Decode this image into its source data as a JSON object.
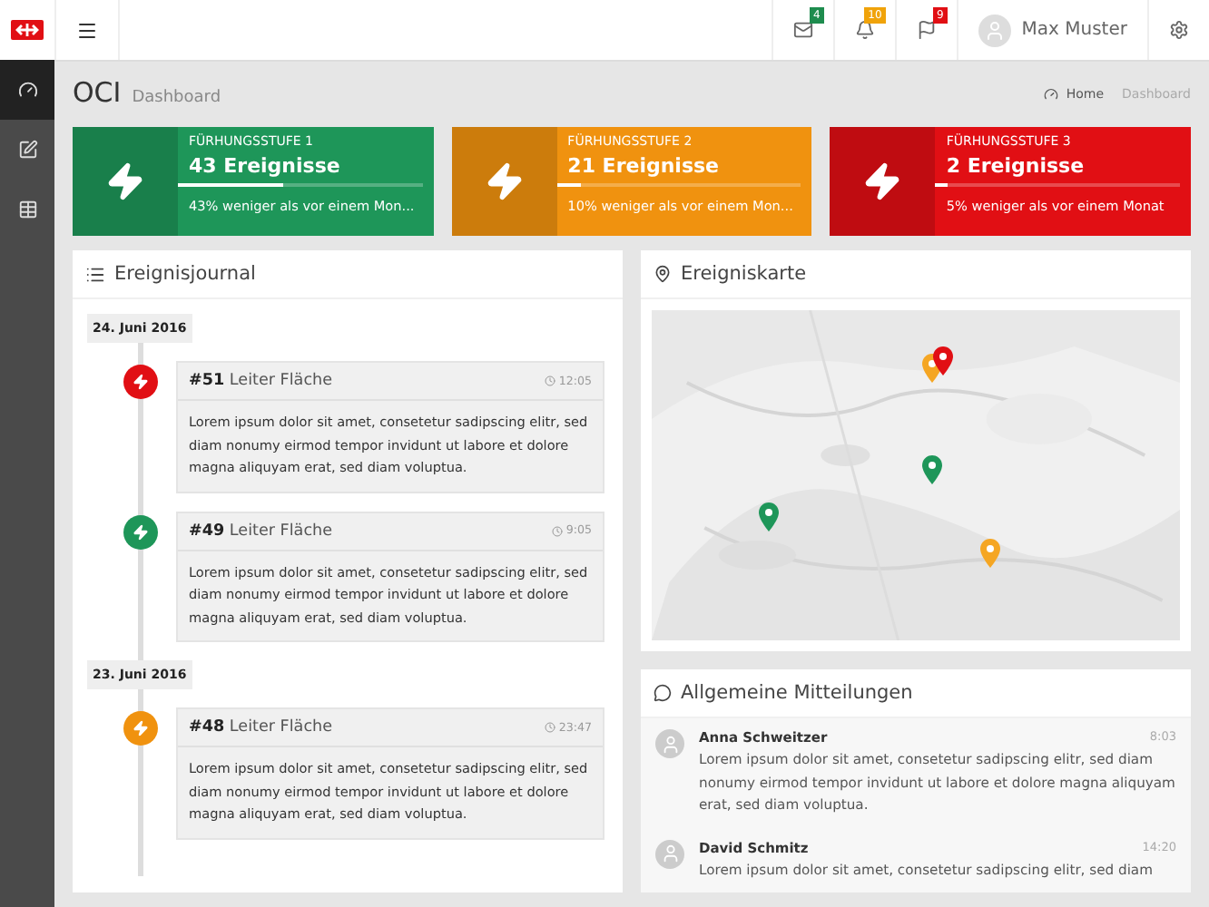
{
  "topbar": {
    "badges": [
      {
        "kind": "mail",
        "count": "4",
        "color": "#1e8c4e"
      },
      {
        "kind": "bell",
        "count": "10",
        "color": "#f0a30a"
      },
      {
        "kind": "flag",
        "count": "9",
        "color": "#e10f14"
      }
    ],
    "user": "Max Muster"
  },
  "sidebar": {
    "items": [
      {
        "kind": "dashboard",
        "selected": true
      },
      {
        "kind": "edit",
        "selected": false
      },
      {
        "kind": "table",
        "selected": false
      }
    ]
  },
  "header": {
    "title": "OCI",
    "subtitle": "Dashboard",
    "breadcrumb": [
      "Home",
      "Dashboard"
    ]
  },
  "stats": [
    {
      "label": "FÜRHUNGSSTUFE 1",
      "value": "43 Ereignisse",
      "note": "43% weniger als vor einem Mon...",
      "level": 0.43,
      "color": "#1e9659"
    },
    {
      "label": "FÜRHUNGSSTUFE 2",
      "value": "21 Ereignisse",
      "note": "10% weniger als vor einem Mon...",
      "level": 0.1,
      "color": "#f0920f"
    },
    {
      "label": "FÜRHUNGSSTUFE 3",
      "value": "2 Ereignisse",
      "note": "5% weniger als vor einem Monat",
      "level": 0.05,
      "color": "#e10f14"
    }
  ],
  "journal": {
    "title": "Ereignisjournal",
    "days": [
      {
        "date": "24. Juni 2016",
        "events": [
          {
            "number": "#51",
            "title": "Leiter Fläche",
            "time": "12:05",
            "color": "#e10f14",
            "text": "Lorem ipsum dolor sit amet, consetetur sadipscing elitr, sed diam nonumy eirmod tempor invidunt ut labore et dolore magna aliquyam erat, sed diam voluptua."
          },
          {
            "number": "#49",
            "title": "Leiter Fläche",
            "time": "9:05",
            "color": "#1e9659",
            "text": "Lorem ipsum dolor sit amet, consetetur sadipscing elitr, sed diam nonumy eirmod tempor invidunt ut labore et dolore magna aliquyam erat, sed diam voluptua."
          }
        ]
      },
      {
        "date": "23. Juni 2016",
        "events": [
          {
            "number": "#48",
            "title": "Leiter Fläche",
            "time": "23:47",
            "color": "#f0920f",
            "text": "Lorem ipsum dolor sit amet, consetetur sadipscing elitr, sed diam nonumy eirmod tempor invidunt ut labore et dolore magna aliquyam erat, sed diam voluptua."
          }
        ]
      }
    ]
  },
  "map": {
    "title": "Ereigniskarte",
    "pins": [
      {
        "color": "#f5a623"
      },
      {
        "color": "#e10f14"
      },
      {
        "color": "#1e9659"
      },
      {
        "color": "#1e9659"
      },
      {
        "color": "#f5a623"
      }
    ]
  },
  "messages": {
    "title": "Allgemeine Mitteilungen",
    "items": [
      {
        "name": "Anna Schweitzer",
        "time": "8:03",
        "text": "Lorem ipsum dolor sit amet, consetetur sadipscing elitr, sed diam nonumy eirmod tempor invidunt ut labore et dolore magna aliquyam erat, sed diam voluptua."
      },
      {
        "name": "David Schmitz",
        "time": "14:20",
        "text": "Lorem ipsum dolor sit amet, consetetur sadipscing elitr, sed diam"
      }
    ]
  }
}
